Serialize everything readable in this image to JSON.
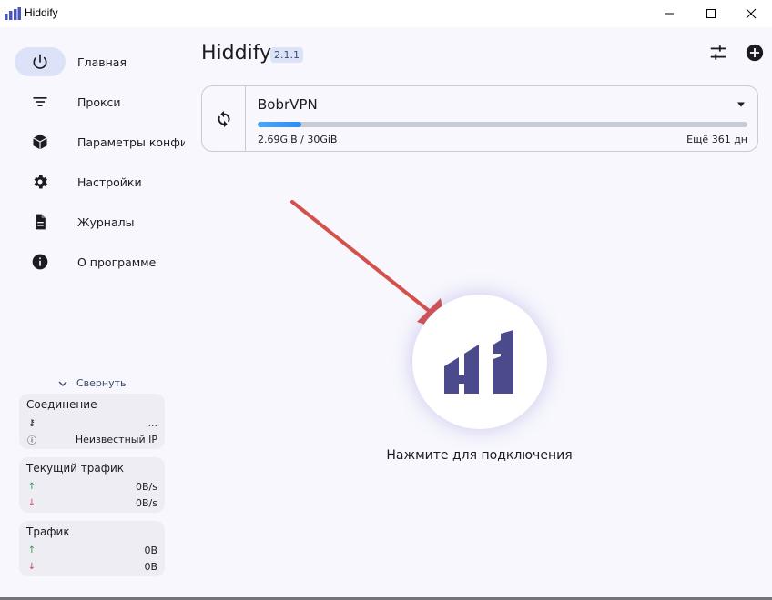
{
  "window": {
    "title": "Hiddify"
  },
  "sidebar": {
    "items": [
      {
        "label": "Главная",
        "icon": "power-icon",
        "active": true
      },
      {
        "label": "Прокси",
        "icon": "filter-icon",
        "active": false
      },
      {
        "label": "Параметры конфи",
        "icon": "cube-icon",
        "active": false
      },
      {
        "label": "Настройки",
        "icon": "gear-icon",
        "active": false
      },
      {
        "label": "Журналы",
        "icon": "document-icon",
        "active": false
      },
      {
        "label": "О программе",
        "icon": "info-icon",
        "active": false
      }
    ],
    "collapse_label": "Свернуть"
  },
  "stats": {
    "connection": {
      "title": "Соединение",
      "row1_value": "...",
      "row2_value": "Неизвестный IP"
    },
    "current_traffic": {
      "title": "Текущий трафик",
      "up_icon": "↑",
      "down_icon": "↓",
      "up_value": "0B/s",
      "down_value": "0B/s"
    },
    "traffic": {
      "title": "Трафик",
      "up_icon": "↑",
      "down_icon": "↓",
      "up_value": "0B",
      "down_value": "0B"
    }
  },
  "header": {
    "title": "Hiddify",
    "version": "2.1.1"
  },
  "profile": {
    "name": "BobrVPN",
    "usage": "2.69GiB / 30GiB",
    "usage_fraction": 0.09,
    "remaining": "Ещё 361 дн"
  },
  "connect": {
    "label": "Нажмите для подключения"
  },
  "colors": {
    "accent": "#4a4a8c",
    "nav_active_bg": "#dce3f8",
    "progress": "#2f8cf2",
    "annotation_arrow": "#d6504a"
  }
}
